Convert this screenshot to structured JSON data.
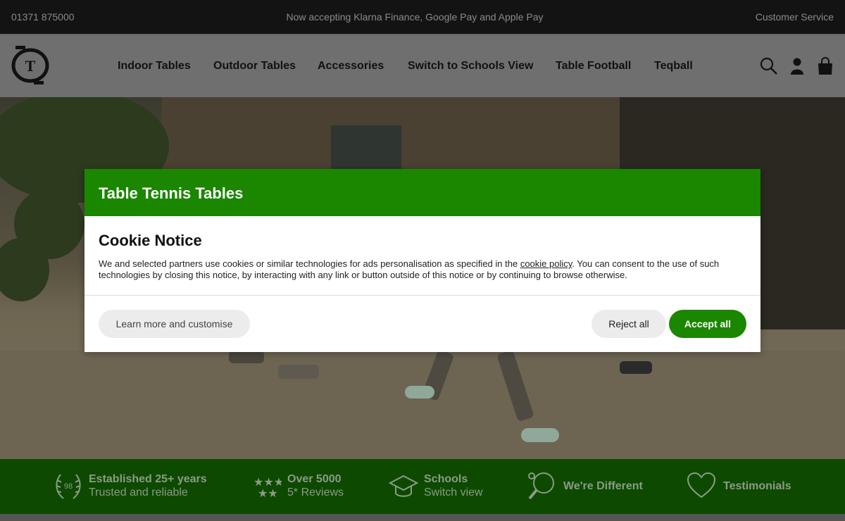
{
  "topbar": {
    "phone": "01371 875000",
    "promo": "Now accepting Klarna Finance, Google Pay and Apple Pay",
    "service": "Customer Service"
  },
  "header": {
    "logo_letter": "T",
    "nav": [
      "Indoor Tables",
      "Outdoor Tables",
      "Accessories",
      "Switch to Schools View",
      "Table Football",
      "Teqball"
    ],
    "icons": [
      "search-icon",
      "account-icon",
      "basket-icon"
    ]
  },
  "modal": {
    "brand": "Table Tennis Tables",
    "title": "Cookie Notice",
    "text_before_link": "We and selected partners use cookies or similar technologies for ads personalisation as specified in the ",
    "link": "cookie policy",
    "text_after_link": ". You can consent to the use of such technologies by closing this notice, by interacting with any link or button outside of this notice or by continuing to browse otherwise.",
    "learn_more": "Learn more and customise",
    "reject": "Reject all",
    "accept": "Accept all",
    "accent": "#1b8600"
  },
  "features": [
    {
      "icon": "laurel-98-icon",
      "badge": "98",
      "line1": "Established 25+ years",
      "line2": "Trusted and reliable"
    },
    {
      "icon": "stars-icon",
      "line1": "Over 5000",
      "line2": "5* Reviews"
    },
    {
      "icon": "graduation-cap-icon",
      "line1": "Schools",
      "line2": "Switch view"
    },
    {
      "icon": "paddle-icon",
      "line1": "We're Different"
    },
    {
      "icon": "heart-icon",
      "line1": "Testimonials"
    }
  ]
}
